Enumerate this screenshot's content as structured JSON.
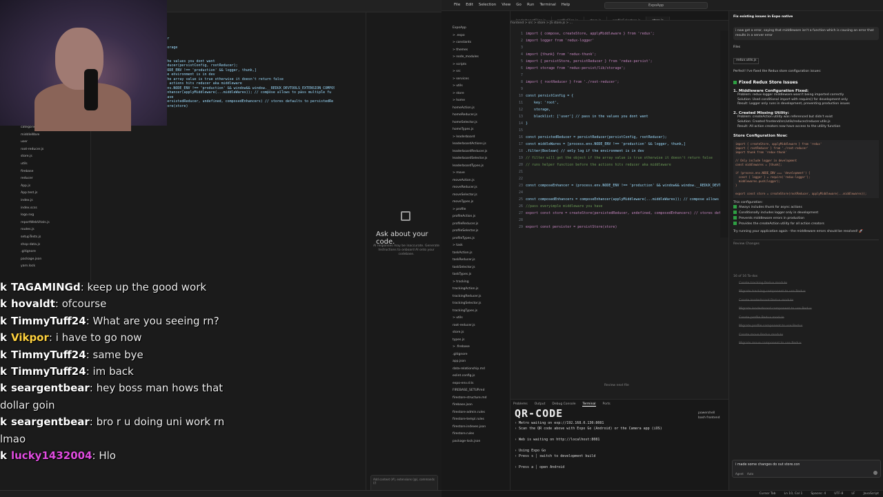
{
  "left_editor": {
    "code_lines": [
      "applyMiddleware } from 'redux';",
      "",
      "'redux-logger';",
      "",
      "// store is before ducing and after",
      "Reducer } from 'redux-persist';",
      "dist/lib/storage'; //uses local storage",
      "",
      "",
      "'root-reducer';",
      "",
      "",
      "  storage,",
      "  blacklist: ['user'] // pass in the values you dont want",
      "",
      "",
      "const persistedReducer = persistReducer(persistConfig, rootReducer);",
      "const middleWares = [process.env.NODE_ENV !== 'production' && logger, thunk,]",
      ".filter(Boolean) // only log if the environment is in dev",
      "// filter will get the object if the array value is true otherwise it doesn't return false",
      "// runs helper function before the actions hits reducer aka middleware",
      "",
      "",
      "",
      "const composeEnhancer = (process.env.NODE_ENV !== 'production' && window&& window.__REDUX_DEVTOOLS_EXTENSION_COMPOSE",
      "",
      "const composedEnhancers = composeEnhancer(applyMiddleware(...middleWares)); // compose allows to pass multiple fu",
      "//pass everyimple middleware you have",
      "export const store = createStore(persistedReducer, undefined, composedEnhancers) // stores defaults to persistedRe",
      "",
      "export const persistor = persistStore(store)"
    ],
    "sidebar_items": [
      "categories",
      "middleWare",
      "user",
      "root-reducer.js",
      "store.js",
      "utils",
      "firebase",
      "reducer",
      "App.js",
      "App.test.js",
      "index.js",
      "index.scss",
      "logo.svg",
      "reportWebVitals.js",
      "routes.js",
      "setupTests.js",
      "shop-data.js",
      ".gitignore",
      "package.json",
      "yarn.lock"
    ],
    "chat_panel": {
      "title": "Ask about your code.",
      "subtitle": "AI responses may be inaccurate. Generate Instructions to onboard AI onto your codebase."
    },
    "chat_input_hint": "Add context (#), extensions (@), commands (/)"
  },
  "chat": {
    "messages": [
      {
        "user": "TAGAMINGd",
        "text": "keep up the good work",
        "color": "#ffffff"
      },
      {
        "user": "hovaldt",
        "text": "ofcourse",
        "color": "#ffffff"
      },
      {
        "user": "TimmyTuff24",
        "text": "What are you seeing rn?",
        "color": "#ffffff"
      },
      {
        "user": "Vikpor",
        "text": "i have to go now",
        "color": "#ffd23f"
      },
      {
        "user": "TimmyTuff24",
        "text": "same bye",
        "color": "#ffffff"
      },
      {
        "user": "TimmyTuff24",
        "text": "im back",
        "color": "#ffffff"
      },
      {
        "user": "seargentbear",
        "text": "hey boss man hows that dollar goin",
        "color": "#ffffff"
      },
      {
        "user": "seargentbear",
        "text": "bro r u doing uni work rn lmao",
        "color": "#ffffff"
      },
      {
        "user": "lucky1432004",
        "text": "Hlo",
        "color": "#e04ce0"
      }
    ],
    "badge": "k"
  },
  "vscode": {
    "menu": [
      "File",
      "Edit",
      "Selection",
      "View",
      "Go",
      "Run",
      "Terminal",
      "Help"
    ],
    "search_text": "ExpoApp",
    "tabs": [
      "leaderboardSlice.js",
      "profileSlice.js",
      "store.js",
      "profileSelectors.js",
      "store.js"
    ],
    "active_tab": 4,
    "breadcrumb": "frontend > src > store > JS store.js > ...",
    "code": [
      {
        "n": "1",
        "t": "import { compose, createStore, applyMiddleware } from 'redux';"
      },
      {
        "n": "2",
        "t": "import logger from 'redux-logger'"
      },
      {
        "n": "3",
        "t": ""
      },
      {
        "n": "4",
        "t": "import {thunk} from 'redux-thunk';"
      },
      {
        "n": "5",
        "t": "import { persistStore, persistReducer } from 'redux-persist';"
      },
      {
        "n": "6",
        "t": "import storage from 'redux-persist/lib/storage';"
      },
      {
        "n": "7",
        "t": ""
      },
      {
        "n": "8",
        "t": "import { rootReducer } from './root-reducer';"
      },
      {
        "n": "9",
        "t": ""
      },
      {
        "n": "10",
        "t": "const persistConfig = {"
      },
      {
        "n": "11",
        "t": "    key: 'root',"
      },
      {
        "n": "12",
        "t": "    storage,"
      },
      {
        "n": "13",
        "t": "    blacklist: ['user'] // pass in the values you dont want"
      },
      {
        "n": "14",
        "t": "}"
      },
      {
        "n": "15",
        "t": ""
      },
      {
        "n": "16",
        "t": "const persistedReducer = persistReducer(persistConfig, rootReducer);"
      },
      {
        "n": "17",
        "t": "const middleWares = [process.env.NODE_ENV !== 'production' && logger, thunk,]"
      },
      {
        "n": "18",
        "t": ".filter(Boolean) // only log if the environment is in dev"
      },
      {
        "n": "19",
        "t": "// filter will get the object if the array value is true otherwise it doesn't return false"
      },
      {
        "n": "20",
        "t": "// runs helper function before the actions hits reducer aka middleware"
      },
      {
        "n": "21",
        "t": ""
      },
      {
        "n": "22",
        "t": ""
      },
      {
        "n": "23",
        "t": "const composeEnhancer = (process.env.NODE_ENV !== 'production' && window&& window.__REDUX_DEVTOO"
      },
      {
        "n": "24",
        "t": ""
      },
      {
        "n": "25",
        "t": "const composedEnhancers = composeEnhancer(applyMiddleware(...middleWares)); // compose allows to"
      },
      {
        "n": "26",
        "t": "//pass everyimple middleware you have"
      },
      {
        "n": "27",
        "t": "export const store = createStore(persistedReducer, undefined, composedEnhancers) // stores defa"
      },
      {
        "n": "28",
        "t": ""
      },
      {
        "n": "29",
        "t": "export const persistor = persistStore(store)"
      }
    ],
    "explorer": [
      "ExpoApp",
      "> .expo",
      "> constants",
      "> themes",
      "> node_modules",
      "> scripts",
      "> src",
      "  > services",
      "  > utils",
      "  > store",
      "    > home",
      "      homeAction.js",
      "      homeReducer.js",
      "      homeSelector.js",
      "      homeTypes.js",
      "    > leaderboard",
      "      leaderboardActions.js",
      "      leaderboardReducer.js",
      "      leaderboardSelector.js",
      "      leaderboardTypes.js",
      "    > move",
      "      moveAction.js",
      "      moveReducer.js",
      "      moveSelector.js",
      "      moveTypes.js",
      "    > profile",
      "      profileAction.js",
      "      profileReducer.js",
      "      profileSelector.js",
      "      profileTypes.js",
      "    > task",
      "      taskAction.js",
      "      taskReducer.js",
      "      taskSelector.js",
      "      taskTypes.js",
      "    > tracking",
      "      trackingAction.js",
      "      trackingReducer.js",
      "      trackingSelector.js",
      "      trackingTypes.js",
      "  > utils",
      "  root-reducer.js",
      "  store.js",
      "  types.js",
      "> .firebase",
      ".gitignore",
      "app.json",
      "data-relationship.md",
      "eslint.config.js",
      "expo-env.d.ts",
      "FIREBASE_SETUP.md",
      "firestore-structure.md",
      "firebase.json",
      "firestore-admin.rules",
      "firestore-templ.rules",
      "firestore.indexes.json",
      "firestore.rules",
      "package-lock.json"
    ],
    "review_hint": "Review next file",
    "panel_tabs": [
      "Problems",
      "Output",
      "Debug Console",
      "Terminal",
      "Ports"
    ],
    "active_panel_tab": 3,
    "terminal": {
      "banner": "QR-CODE",
      "lines": [
        "› Metro waiting on exp://192.168.0.130:8081",
        "› Scan the QR code above with Expo Go (Android) or the Camera app (iOS)",
        "",
        "› Web is waiting on http://localhost:8081",
        "",
        "› Using Expo Go",
        "› Press s │ switch to development build",
        "",
        "› Press a │ open Android"
      ],
      "side": [
        "powershell",
        "bash frontend"
      ]
    },
    "copilot": {
      "title": "Fix existing issues in Expo native",
      "user_msg": "i now get a error, saying that middleware isn't a function which is causing an error that results in a server error",
      "files_label": "Files",
      "file_chip": "redux.utils.js",
      "answer_intro": "Perfect! I've fixed the Redux store configuration issues:",
      "fixed_heading": "Fixed Redux Store Issues",
      "sections": [
        {
          "heading": "1. Middleware Configuration Fixed:",
          "items": [
            "Problem: redux-logger middleware wasn't being imported correctly",
            "Solution: Used conditional import with require() for development only",
            "Result: Logger only runs in development, preventing production issues"
          ]
        },
        {
          "heading": "2. Created Missing Utility:",
          "items": [
            "Problem: createAction utility was referenced but didn't exist",
            "Solution: Created frontend/src/utils/reducer/reducer.utils.js",
            "Result: All action creators now have access to the utility function"
          ]
        }
      ],
      "store_config_heading": "Store Configuration Now:",
      "code_block": "import { createStore, applyMiddleware } from 'redux'\nimport { rootReducer } from './root-reducer'\nimport thunk from 'redux-thunk'\n\n// Only include logger in development\nconst middlewares = [thunk];\n\nif (process.env.NODE_ENV === 'development') {\n  const { logger } = require('redux-logger');\n  middlewares.push(logger);\n}\n\nexport const store = createStore(rootReducer, applyMiddleware(...middlewares));",
      "config_heading": "This configuration:",
      "config_items": [
        "Always includes thunk for async actions",
        "Conditionally includes logger only in development",
        "Prevents middleware errors in production",
        "Provides the createAction utility for all action creators"
      ],
      "closing": "Try running your application again - the middleware errors should be resolved! 🚀",
      "review_label": "Review Changes",
      "todo_header": "16 of 16 To-dos",
      "todos": [
        "Create tracking Redux module",
        "Migrate tracking component to use Redux",
        "Create leaderboard Redux module",
        "Migrate leaderboard component to use Redux",
        "Create profile Redux module",
        "Migrate profile component to use Redux",
        "Create move Redux module",
        "Migrate move component to use Redux"
      ],
      "input_text": "i made some changes do out store.con",
      "mode_label": "Agent",
      "model_label": "Auto"
    },
    "status": [
      "Cursor Tab",
      "Ln 10, Col 1",
      "Spaces: 4",
      "UTF-8",
      "LF",
      "JavaScript"
    ]
  }
}
